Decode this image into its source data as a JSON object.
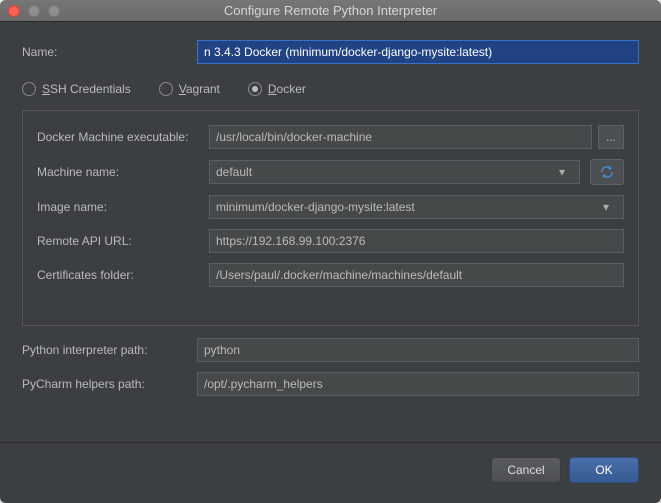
{
  "window": {
    "title": "Configure Remote Python Interpreter"
  },
  "name": {
    "label": "Name:",
    "value": "n 3.4.3 Docker (minimum/docker-django-mysite:latest)"
  },
  "connection_type": {
    "ssh": {
      "prefix": "S",
      "rest": "SH Credentials"
    },
    "vagrant": {
      "prefix": "V",
      "rest": "agrant"
    },
    "docker": {
      "prefix": "D",
      "rest": "ocker"
    },
    "selected": "docker"
  },
  "docker": {
    "executable_label": "Docker Machine executable:",
    "executable_value": "/usr/local/bin/docker-machine",
    "machine_label": "Machine name:",
    "machine_value": "default",
    "image_label": "Image name:",
    "image_value": "minimum/docker-django-mysite:latest",
    "api_label": "Remote API URL:",
    "api_value": "https://192.168.99.100:2376",
    "cert_label": "Certificates folder:",
    "cert_value": "/Users/paul/.docker/machine/machines/default"
  },
  "python_path": {
    "label": "Python interpreter path:",
    "value": "python"
  },
  "helpers_path": {
    "label": "PyCharm helpers path:",
    "value": "/opt/.pycharm_helpers"
  },
  "buttons": {
    "cancel": "Cancel",
    "ok": "OK",
    "ellipsis": "..."
  }
}
